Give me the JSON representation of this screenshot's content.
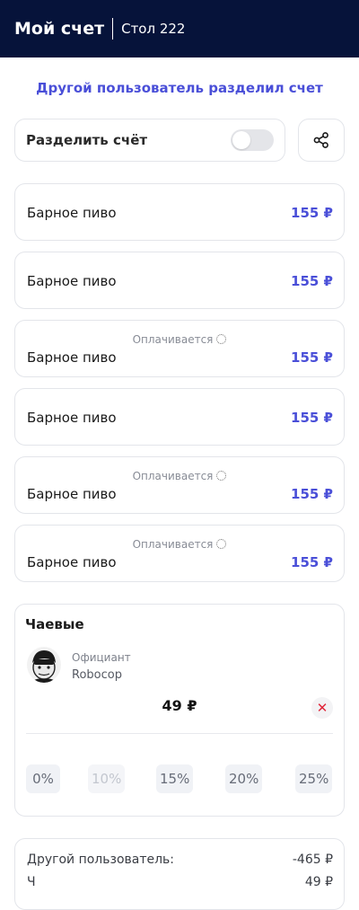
{
  "header": {
    "title": "Мой счет",
    "table": "Стол 222"
  },
  "notice": "Другой пользователь разделил счет",
  "split": {
    "label": "Разделить счёт",
    "toggle_on": false
  },
  "items": [
    {
      "name": "Барное пиво",
      "price": "155 ₽",
      "status": ""
    },
    {
      "name": "Барное пиво",
      "price": "155 ₽",
      "status": ""
    },
    {
      "name": "Барное пиво",
      "price": "155 ₽",
      "status": "Оплачивается"
    },
    {
      "name": "Барное пиво",
      "price": "155 ₽",
      "status": ""
    },
    {
      "name": "Барное пиво",
      "price": "155 ₽",
      "status": "Оплачивается"
    },
    {
      "name": "Барное пиво",
      "price": "155 ₽",
      "status": "Оплачивается"
    }
  ],
  "tips": {
    "heading": "Чаевые",
    "waiter_role": "Официант",
    "waiter_name": "Robocop",
    "amount": "49 ₽",
    "options": [
      {
        "label": "0%",
        "disabled": false
      },
      {
        "label": "10%",
        "disabled": true
      },
      {
        "label": "15%",
        "disabled": false
      },
      {
        "label": "20%",
        "disabled": false
      },
      {
        "label": "25%",
        "disabled": false
      }
    ]
  },
  "summary": {
    "other_user_label": "Другой пользователь:",
    "other_user_value": "-465 ₽",
    "next_label": "Ч",
    "next_value": "49 ₽"
  },
  "colors": {
    "header_bg": "#06133a",
    "accent": "#4a4fd8",
    "clear": "#e0263a"
  }
}
